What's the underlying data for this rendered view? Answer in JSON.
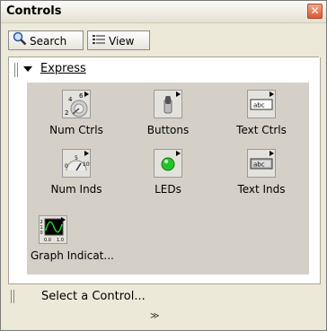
{
  "window": {
    "title": "Controls",
    "close_glyph": "✕"
  },
  "toolbar": {
    "search_label": "Search",
    "view_label": "View"
  },
  "category": {
    "label": "Express"
  },
  "items": [
    {
      "label": "Num Ctrls",
      "icon": "knob-icon",
      "num1": "4",
      "num2": "6",
      "num3": "2"
    },
    {
      "label": "Buttons",
      "icon": "toggle-switch-icon"
    },
    {
      "label": "Text Ctrls",
      "icon": "text-control-icon",
      "text": "abc"
    },
    {
      "label": "Num Inds",
      "icon": "gauge-icon",
      "num1": "0",
      "num2": "5",
      "num3": "10"
    },
    {
      "label": "LEDs",
      "icon": "led-icon"
    },
    {
      "label": "Text Inds",
      "icon": "text-indicator-icon",
      "text": "abc"
    },
    {
      "label": "Graph Indicat...",
      "icon": "graph-icon",
      "ticks": [
        "2",
        "1",
        "0",
        "0.0",
        "1.0"
      ]
    }
  ],
  "status": {
    "text": "Select a Control...",
    "chevron": "≫"
  },
  "colors": {
    "palette_bg": "#d4d0c8",
    "led": "#26c326",
    "graph_bg": "#000000",
    "graph_line": "#29d329"
  }
}
